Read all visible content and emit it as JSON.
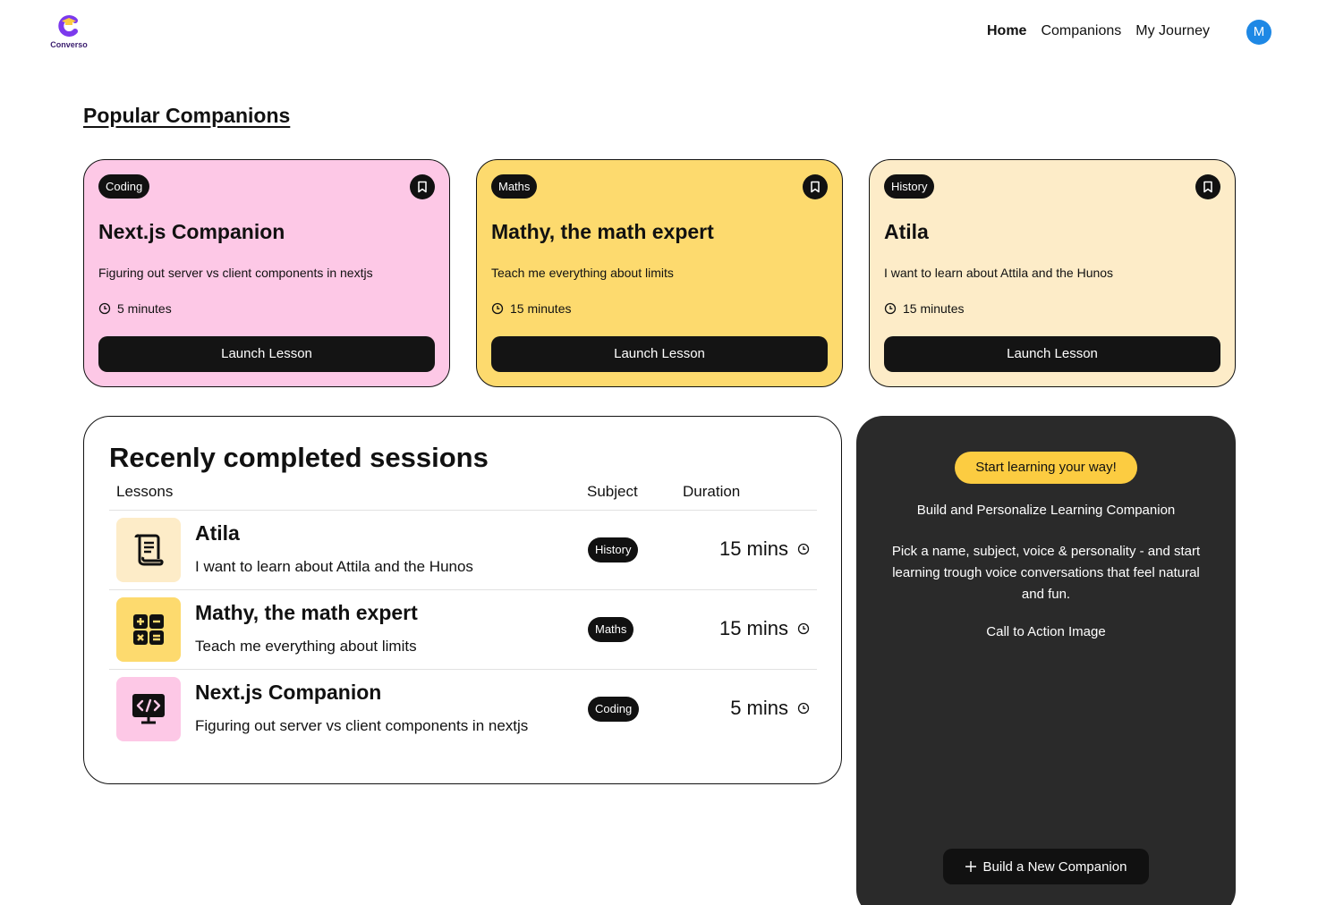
{
  "logo": {
    "text": "Converso",
    "icon": "converso-logo-icon"
  },
  "nav": {
    "links": [
      "Home",
      "Companions",
      "My Journey"
    ],
    "avatar_initial": "M"
  },
  "popular": {
    "title": "Popular Companions",
    "cards": [
      {
        "subject": "Coding",
        "name": "Next.js Companion",
        "topic": "Figuring out server vs client components in nextjs",
        "duration": "5 minutes",
        "button": "Launch Lesson",
        "color": "#fdc8e6"
      },
      {
        "subject": "Maths",
        "name": "Mathy, the math expert",
        "topic": "Teach me everything about limits",
        "duration": "15 minutes",
        "button": "Launch Lesson",
        "color": "#fdda6e"
      },
      {
        "subject": "History",
        "name": "Atila",
        "topic": "I want to learn about Attila and the Hunos",
        "duration": "15 minutes",
        "button": "Launch Lesson",
        "color": "#fdecc8"
      }
    ]
  },
  "recent": {
    "title": "Recenly completed sessions",
    "headers": {
      "lessons": "Lessons",
      "subject": "Subject",
      "duration": "Duration"
    },
    "rows": [
      {
        "name": "Atila",
        "topic": "I want to learn about Attila and the Hunos",
        "subject": "History",
        "duration": "15 mins",
        "icon": "scroll-icon",
        "color": "#fdecc8"
      },
      {
        "name": "Mathy, the math expert",
        "topic": "Teach me everything about limits",
        "subject": "Maths",
        "duration": "15 mins",
        "icon": "calculator-icon",
        "color": "#fdda6e"
      },
      {
        "name": "Next.js Companion",
        "topic": "Figuring out server vs client components in nextjs",
        "subject": "Coding",
        "duration": "5 mins",
        "icon": "code-monitor-icon",
        "color": "#fdc8e6"
      }
    ]
  },
  "cta": {
    "pill": "Start learning your way!",
    "heading": "Build and Personalize Learning Companion",
    "description": "Pick a name, subject, voice & personality - and start learning trough voice conversations that feel natural and fun.",
    "image_alt": "Call to Action Image",
    "button": "Build a New Companion",
    "bg": "#2a2a2a",
    "accent": "#fccc41"
  }
}
